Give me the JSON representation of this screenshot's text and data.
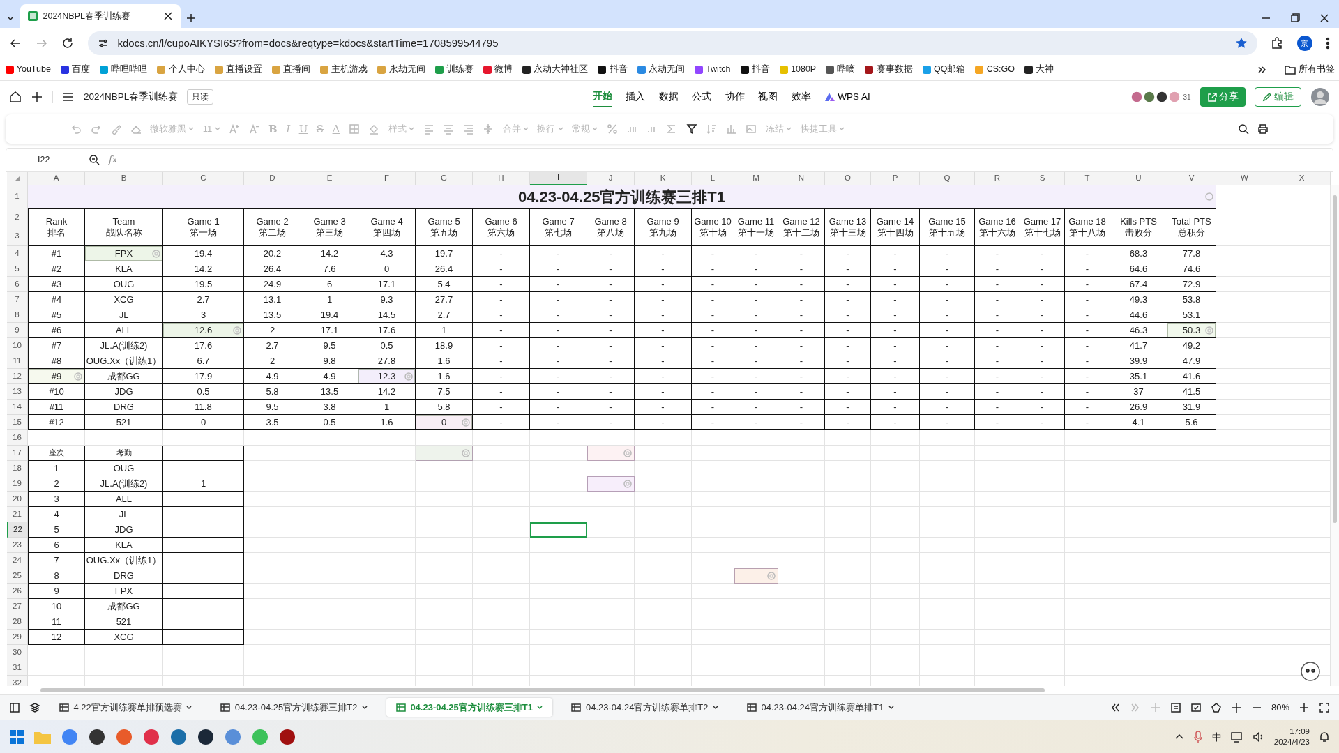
{
  "browser": {
    "tab_title": "2024NBPL春季训练赛",
    "address": "kdocs.cn/l/cupoAIKYSI6S?from=docs&reqtype=kdocs&startTime=1708599544795",
    "profile": "京",
    "bookmarks": [
      "YouTube",
      "百度",
      "哔哩哔哩",
      "个人中心",
      "直播设置",
      "直播间",
      "主机游戏",
      "永劫无间",
      "训练赛",
      "微博",
      "永劫大神社区",
      "抖音",
      "永劫无间",
      "Twitch",
      "抖音",
      "1080P",
      "哔嘀",
      "赛事数据",
      "QQ邮箱",
      "CS:GO",
      "大神"
    ],
    "all_bookmarks": "所有书签"
  },
  "app": {
    "doc_title": "2024NBPL春季训练赛",
    "badge": "只读",
    "menu": [
      {
        "label": "开始",
        "selected": true
      },
      {
        "label": "插入",
        "selected": false
      },
      {
        "label": "数据",
        "selected": false
      },
      {
        "label": "公式",
        "selected": false
      },
      {
        "label": "协作",
        "selected": false
      },
      {
        "label": "视图",
        "selected": false
      },
      {
        "label": "效率",
        "selected": false
      },
      {
        "label": "WPS AI",
        "selected": false
      }
    ],
    "collaborator_count": "31",
    "share": "分享",
    "edit": "编辑"
  },
  "toolbar": [
    {
      "kind": "icon",
      "disabled": true
    },
    {
      "kind": "icon",
      "disabled": true
    },
    {
      "kind": "icon",
      "disabled": true
    },
    {
      "kind": "icon",
      "disabled": true
    },
    {
      "kind": "dropdown",
      "label": "微软雅黑",
      "disabled": true
    },
    {
      "kind": "dropdown",
      "label": "11",
      "disabled": true
    },
    {
      "kind": "icon",
      "disabled": true
    },
    {
      "kind": "icon",
      "disabled": true
    },
    {
      "kind": "glyph",
      "label": "B",
      "disabled": true
    },
    {
      "kind": "glyph",
      "label": "I",
      "disabled": true
    },
    {
      "kind": "glyph",
      "label": "U",
      "disabled": true
    },
    {
      "kind": "glyph",
      "label": "S",
      "disabled": true
    },
    {
      "kind": "glyph",
      "label": "A",
      "disabled": true
    },
    {
      "kind": "icon",
      "disabled": true
    },
    {
      "kind": "icon",
      "disabled": true
    },
    {
      "kind": "dropdown",
      "label": "样式",
      "disabled": true
    },
    {
      "kind": "icon",
      "disabled": true
    },
    {
      "kind": "icon",
      "disabled": true
    },
    {
      "kind": "icon",
      "disabled": true
    },
    {
      "kind": "icon",
      "disabled": true
    },
    {
      "kind": "dropdown",
      "label": "合并",
      "disabled": true
    },
    {
      "kind": "dropdown",
      "label": "换行",
      "disabled": true
    },
    {
      "kind": "dropdown",
      "label": "常规",
      "disabled": true
    },
    {
      "kind": "icon",
      "disabled": true
    },
    {
      "kind": "icon",
      "disabled": true
    },
    {
      "kind": "icon",
      "disabled": true
    },
    {
      "kind": "icon",
      "disabled": true
    },
    {
      "kind": "icon",
      "disabled": false
    },
    {
      "kind": "icon",
      "disabled": true
    },
    {
      "kind": "icon",
      "disabled": true
    },
    {
      "kind": "icon",
      "disabled": true
    },
    {
      "kind": "dropdown",
      "label": "冻结",
      "disabled": true
    },
    {
      "kind": "dropdown",
      "label": "快捷工具",
      "disabled": true
    },
    {
      "kind": "icon",
      "disabled": false
    },
    {
      "kind": "icon",
      "disabled": false
    }
  ],
  "formula_bar": {
    "name_box": "I22",
    "function_label": "fx"
  },
  "sheet": {
    "columns": [
      {
        "label": "A",
        "selected": false
      },
      {
        "label": "B",
        "selected": false
      },
      {
        "label": "C",
        "selected": false
      },
      {
        "label": "D",
        "selected": false
      },
      {
        "label": "E",
        "selected": false
      },
      {
        "label": "F",
        "selected": false
      },
      {
        "label": "G",
        "selected": false
      },
      {
        "label": "H",
        "selected": false
      },
      {
        "label": "I",
        "selected": true
      },
      {
        "label": "J",
        "selected": false
      },
      {
        "label": "K",
        "selected": false
      },
      {
        "label": "L",
        "selected": false
      },
      {
        "label": "M",
        "selected": false
      },
      {
        "label": "N",
        "selected": false
      },
      {
        "label": "O",
        "selected": false
      },
      {
        "label": "P",
        "selected": false
      },
      {
        "label": "Q",
        "selected": false
      },
      {
        "label": "R",
        "selected": false
      },
      {
        "label": "S",
        "selected": false
      },
      {
        "label": "T",
        "selected": false
      },
      {
        "label": "U",
        "selected": false
      },
      {
        "label": "V",
        "selected": false
      },
      {
        "label": "W",
        "selected": false
      },
      {
        "label": "X",
        "selected": false
      }
    ],
    "rows": [
      {
        "label": "1",
        "selected": false
      },
      {
        "label": "2",
        "selected": false
      },
      {
        "label": "3",
        "selected": false
      },
      {
        "label": "4",
        "selected": false
      },
      {
        "label": "5",
        "selected": false
      },
      {
        "label": "6",
        "selected": false
      },
      {
        "label": "7",
        "selected": false
      },
      {
        "label": "8",
        "selected": false
      },
      {
        "label": "9",
        "selected": false
      },
      {
        "label": "10",
        "selected": false
      },
      {
        "label": "11",
        "selected": false
      },
      {
        "label": "12",
        "selected": false
      },
      {
        "label": "13",
        "selected": false
      },
      {
        "label": "14",
        "selected": false
      },
      {
        "label": "15",
        "selected": false
      },
      {
        "label": "16",
        "selected": false
      },
      {
        "label": "17",
        "selected": false
      },
      {
        "label": "18",
        "selected": false
      },
      {
        "label": "19",
        "selected": false
      },
      {
        "label": "20",
        "selected": false
      },
      {
        "label": "21",
        "selected": false
      },
      {
        "label": "22",
        "selected": true
      },
      {
        "label": "23",
        "selected": false
      },
      {
        "label": "24",
        "selected": false
      },
      {
        "label": "25",
        "selected": false
      },
      {
        "label": "26",
        "selected": false
      },
      {
        "label": "27",
        "selected": false
      },
      {
        "label": "28",
        "selected": false
      },
      {
        "label": "29",
        "selected": false
      },
      {
        "label": "30",
        "selected": false
      },
      {
        "label": "31",
        "selected": false
      },
      {
        "label": "32",
        "selected": false
      }
    ],
    "title": "04.23-04.25官方训练赛三排T1",
    "headers": [
      {
        "en": "Rank",
        "zh": "排名"
      },
      {
        "en": "Team",
        "zh": "战队名称"
      },
      {
        "en": "Game 1",
        "zh": "第一场"
      },
      {
        "en": "Game 2",
        "zh": "第二场"
      },
      {
        "en": "Game 3",
        "zh": "第三场"
      },
      {
        "en": "Game 4",
        "zh": "第四场"
      },
      {
        "en": "Game 5",
        "zh": "第五场"
      },
      {
        "en": "Game 6",
        "zh": "第六场"
      },
      {
        "en": "Game 7",
        "zh": "第七场"
      },
      {
        "en": "Game 8",
        "zh": "第八场"
      },
      {
        "en": "Game 9",
        "zh": "第九场"
      },
      {
        "en": "Game 10",
        "zh": "第十场"
      },
      {
        "en": "Game 11",
        "zh": "第十一场"
      },
      {
        "en": "Game 12",
        "zh": "第十二场"
      },
      {
        "en": "Game 13",
        "zh": "第十三场"
      },
      {
        "en": "Game 14",
        "zh": "第十四场"
      },
      {
        "en": "Game 15",
        "zh": "第十五场"
      },
      {
        "en": "Game 16",
        "zh": "第十六场"
      },
      {
        "en": "Game 17",
        "zh": "第十七场"
      },
      {
        "en": "Game 18",
        "zh": "第十八场"
      },
      {
        "en": "Kills PTS",
        "zh": "击败分"
      },
      {
        "en": "Total PTS",
        "zh": "总积分"
      }
    ],
    "results": [
      [
        "#1",
        {
          "text": "FPX",
          "color": "#edf5e8"
        },
        "19.4",
        "20.2",
        "14.2",
        "4.3",
        "19.7",
        "-",
        "-",
        "-",
        "-",
        "-",
        "-",
        "-",
        "-",
        "-",
        "-",
        "-",
        "-",
        "-",
        "68.3",
        "77.8"
      ],
      [
        "#2",
        "KLA",
        "14.2",
        "26.4",
        "7.6",
        "0",
        "26.4",
        "-",
        "-",
        "-",
        "-",
        "-",
        "-",
        "-",
        "-",
        "-",
        "-",
        "-",
        "-",
        "-",
        "64.6",
        "74.6"
      ],
      [
        "#3",
        "OUG",
        "19.5",
        "24.9",
        "6",
        "17.1",
        "5.4",
        "-",
        "-",
        "-",
        "-",
        "-",
        "-",
        "-",
        "-",
        "-",
        "-",
        "-",
        "-",
        "-",
        "67.4",
        "72.9"
      ],
      [
        "#4",
        "XCG",
        "2.7",
        "13.1",
        "1",
        "9.3",
        "27.7",
        "-",
        "-",
        "-",
        "-",
        "-",
        "-",
        "-",
        "-",
        "-",
        "-",
        "-",
        "-",
        "-",
        "49.3",
        "53.8"
      ],
      [
        "#5",
        "JL",
        "3",
        "13.5",
        "19.4",
        "14.5",
        "2.7",
        "-",
        "-",
        "-",
        "-",
        "-",
        "-",
        "-",
        "-",
        "-",
        "-",
        "-",
        "-",
        "-",
        "44.6",
        "53.1"
      ],
      [
        "#6",
        "ALL",
        {
          "text": "12.6",
          "color": "#edf5e8"
        },
        "2",
        "17.1",
        "17.6",
        "1",
        "-",
        "-",
        "-",
        "-",
        "-",
        "-",
        "-",
        "-",
        "-",
        "-",
        "-",
        "-",
        "-",
        "46.3",
        {
          "text": "50.3",
          "color": "#f1f8ec"
        }
      ],
      [
        "#7",
        "JL.A(训练2)",
        "17.6",
        "2.7",
        "9.5",
        "0.5",
        "18.9",
        "-",
        "-",
        "-",
        "-",
        "-",
        "-",
        "-",
        "-",
        "-",
        "-",
        "-",
        "-",
        "-",
        "41.7",
        "49.2"
      ],
      [
        "#8",
        "OUG.Xx（训练1）",
        "6.7",
        "2",
        "9.8",
        "27.8",
        "1.6",
        "-",
        "-",
        "-",
        "-",
        "-",
        "-",
        "-",
        "-",
        "-",
        "-",
        "-",
        "-",
        "-",
        "39.9",
        "47.9"
      ],
      [
        {
          "text": "#9",
          "color": "#f6f9ee"
        },
        "成都GG",
        "17.9",
        "4.9",
        "4.9",
        {
          "text": "12.3",
          "color": "#f3eefb"
        },
        "1.6",
        "-",
        "-",
        "-",
        "-",
        "-",
        "-",
        "-",
        "-",
        "-",
        "-",
        "-",
        "-",
        "-",
        "35.1",
        "41.6"
      ],
      [
        "#10",
        "JDG",
        "0.5",
        "5.8",
        "13.5",
        "14.2",
        "7.5",
        "-",
        "-",
        "-",
        "-",
        "-",
        "-",
        "-",
        "-",
        "-",
        "-",
        "-",
        "-",
        "-",
        "37",
        "41.5"
      ],
      [
        "#11",
        "DRG",
        "11.8",
        "9.5",
        "3.8",
        "1",
        "5.8",
        "-",
        "-",
        "-",
        "-",
        "-",
        "-",
        "-",
        "-",
        "-",
        "-",
        "-",
        "-",
        "-",
        "26.9",
        "31.9"
      ],
      [
        "#12",
        "521",
        "0",
        "3.5",
        "0.5",
        "1.6",
        {
          "text": "0",
          "color": "#f8eef5"
        },
        "-",
        "-",
        "-",
        "-",
        "-",
        "-",
        "-",
        "-",
        "-",
        "-",
        "-",
        "-",
        "-",
        "4.1",
        "5.6"
      ]
    ],
    "attendance": [
      [
        "座次",
        "考勤"
      ],
      [
        "1",
        "OUG"
      ],
      [
        "2",
        "JL.A(训练2)",
        "1"
      ],
      [
        "3",
        "ALL"
      ],
      [
        "4",
        "JL"
      ],
      [
        "5",
        "JDG"
      ],
      [
        "6",
        "KLA"
      ],
      [
        "7",
        "OUG.Xx（训练1）"
      ],
      [
        "8",
        "DRG"
      ],
      [
        "9",
        "FPX"
      ],
      [
        "10",
        "成都GG"
      ],
      [
        "11",
        "521"
      ],
      [
        "12",
        "XCG"
      ]
    ],
    "highlighted_empty_cells": [
      {
        "color": "#eef3ec"
      },
      {
        "color": "#fdf2f3"
      },
      {
        "color": "#f7eefb"
      },
      {
        "color": "#fcf0e8"
      }
    ]
  },
  "sheet_tabs": [
    {
      "label": "4.22官方训练赛单排预选赛",
      "selected": false
    },
    {
      "label": "04.23-04.25官方训练赛三排T2",
      "selected": false
    },
    {
      "label": "04.23-04.25官方训练赛三排T1",
      "selected": true
    },
    {
      "label": "04.23-04.24官方训练赛单排T2",
      "selected": false
    },
    {
      "label": "04.23-04.24官方训练赛单排T1",
      "selected": false
    }
  ],
  "zoom": "80%",
  "taskbar": {
    "ime": "中",
    "time": "17:09",
    "date": "2024/4/23"
  }
}
